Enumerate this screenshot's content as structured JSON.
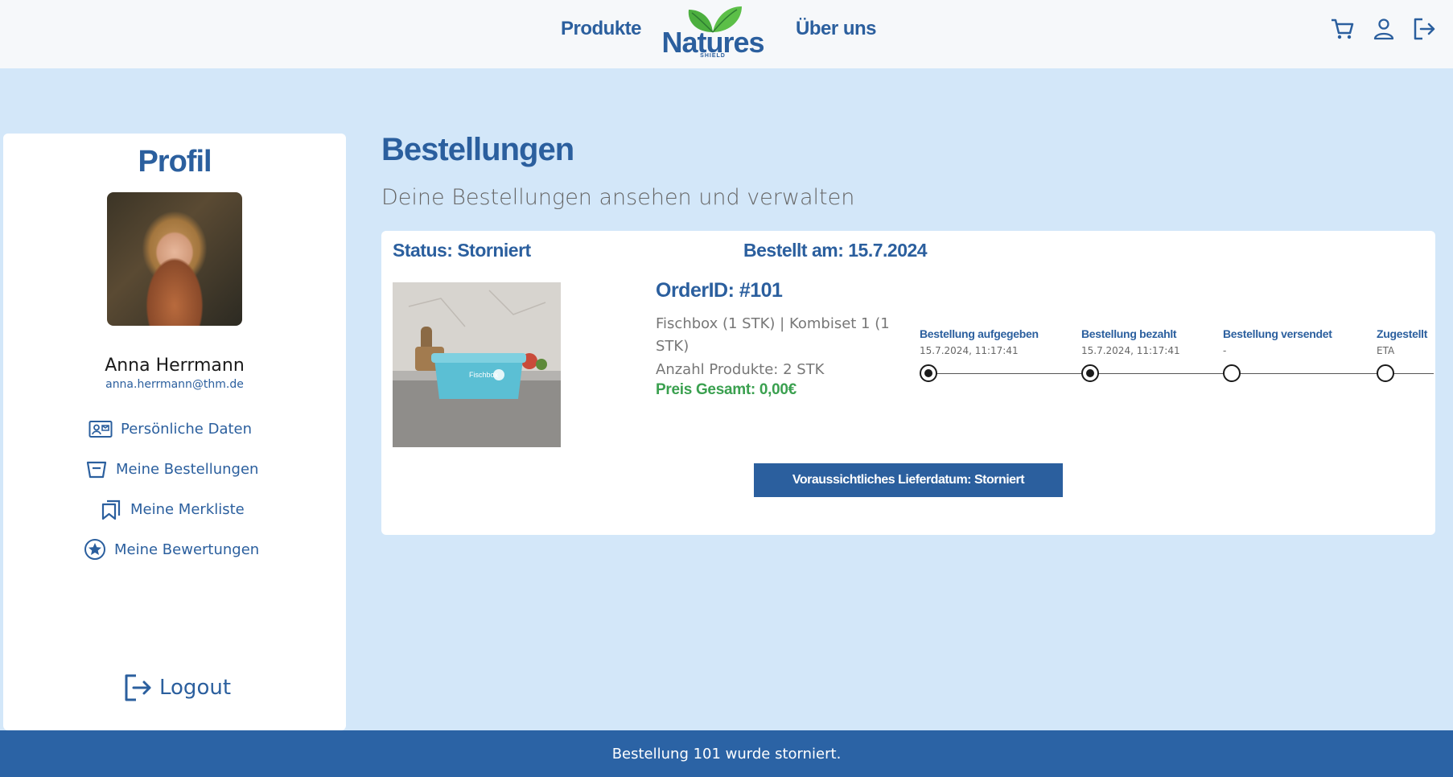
{
  "header": {
    "nav_products": "Produkte",
    "nav_about": "Über uns",
    "logo_text": "Natures",
    "logo_sub": "SHIELD",
    "icons": [
      "cart-icon",
      "user-icon",
      "logout-icon"
    ]
  },
  "sidebar": {
    "title": "Profil",
    "name": "Anna Herrmann",
    "email": "anna.herrmann@thm.de",
    "items": [
      {
        "label": "Persönliche Daten",
        "icon": "contact-card-icon"
      },
      {
        "label": "Meine Bestellungen",
        "icon": "basket-icon"
      },
      {
        "label": "Meine Merkliste",
        "icon": "bookmark-icon"
      },
      {
        "label": "Meine Bewertungen",
        "icon": "star-icon"
      }
    ],
    "logout": "Logout"
  },
  "main": {
    "title": "Bestellungen",
    "subtitle": "Deine Bestellungen ansehen und verwalten",
    "order": {
      "status": "Status: Storniert",
      "ordered_on": "Bestellt am: 15.7.2024",
      "image_label": "Fischbox",
      "order_id": "OrderID: #101",
      "items_line1": "Fischbox (1 STK) | Kombiset 1 (1",
      "items_line2": "STK)",
      "count": "Anzahl Produkte: 2 STK",
      "total": "Preis Gesamt: 0,00€",
      "timeline": [
        {
          "label": "Bestellung aufgegeben",
          "date": "15.7.2024, 11:17:41",
          "done": true
        },
        {
          "label": "Bestellung bezahlt",
          "date": "15.7.2024, 11:17:41",
          "done": true
        },
        {
          "label": "Bestellung versendet",
          "date": "-",
          "done": false
        },
        {
          "label": "Zugestellt",
          "date": "ETA",
          "done": false
        }
      ],
      "eta_button": "Voraussichtliches Lieferdatum: Storniert"
    }
  },
  "toast": "Bestellung 101 wurde storniert.",
  "colors": {
    "brand_blue": "#2b5f9e",
    "page_bg": "#d3e7f9",
    "price_green": "#3aa04f",
    "leaf_green": "#4caf3f"
  }
}
